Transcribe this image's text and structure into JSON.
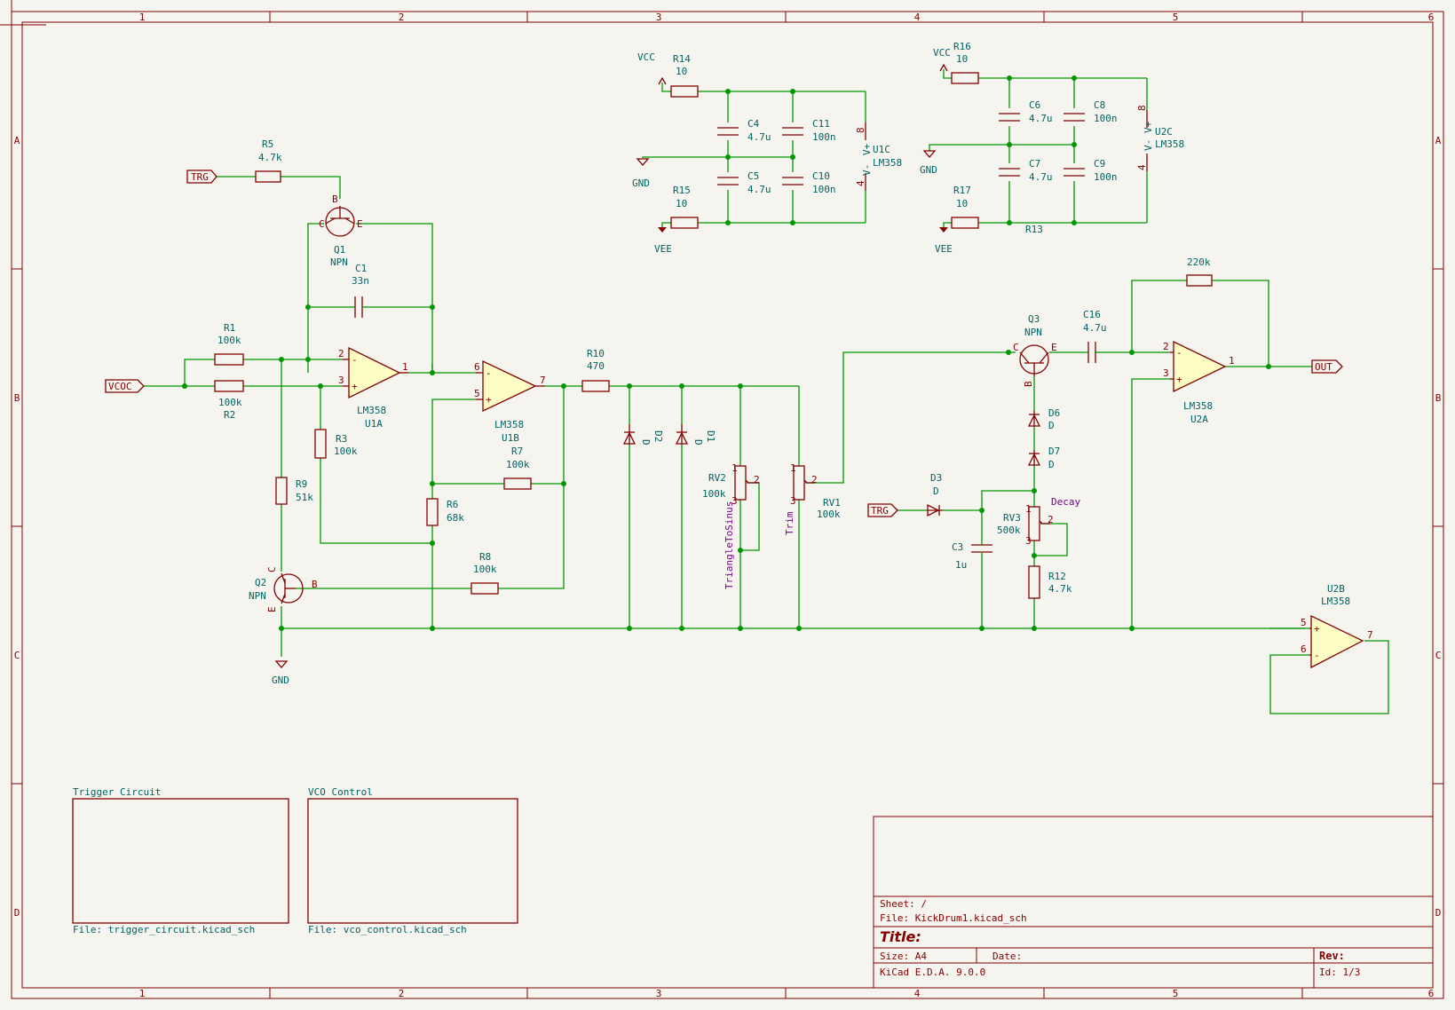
{
  "frame": {
    "columns": [
      "1",
      "2",
      "3",
      "4",
      "5",
      "6"
    ],
    "rows": [
      "A",
      "B",
      "C",
      "D"
    ]
  },
  "title_block": {
    "sheet": "Sheet: /",
    "file": "File: KickDrum1.kicad_sch",
    "title": "Title:",
    "size": "Size: A4",
    "date": "Date:",
    "rev": "Rev:",
    "tool": "KiCad E.D.A. 9.0.0",
    "id": "Id: 1/3"
  },
  "hier_sheets": [
    {
      "name": "Trigger Circuit",
      "file": "File: trigger_circuit.kicad_sch"
    },
    {
      "name": "VCO Control",
      "file": "File: vco_control.kicad_sch"
    }
  ],
  "labels": {
    "trg": "TRG",
    "vcoc": "VCOC",
    "out": "OUT"
  },
  "power": {
    "vcc": "VCC",
    "vee": "VEE",
    "gnd": "GND"
  },
  "components": {
    "r1": {
      "ref": "R1",
      "val": "100k"
    },
    "r2": {
      "ref": "R2",
      "val": "100k"
    },
    "r3": {
      "ref": "R3",
      "val": "100k"
    },
    "r5": {
      "ref": "R5",
      "val": "4.7k"
    },
    "r6": {
      "ref": "R6",
      "val": "68k"
    },
    "r7": {
      "ref": "R7",
      "val": "100k"
    },
    "r8": {
      "ref": "R8",
      "val": "100k"
    },
    "r9": {
      "ref": "R9",
      "val": "51k"
    },
    "r10": {
      "ref": "R10",
      "val": "470"
    },
    "r12": {
      "ref": "R12",
      "val": "4.7k"
    },
    "r13": {
      "ref": "R13",
      "val": "220k"
    },
    "r14": {
      "ref": "R14",
      "val": "10"
    },
    "r15": {
      "ref": "R15",
      "val": "10"
    },
    "r16": {
      "ref": "R16",
      "val": "10"
    },
    "r17": {
      "ref": "R17",
      "val": "10"
    },
    "c1": {
      "ref": "C1",
      "val": "33n"
    },
    "c3": {
      "ref": "C3",
      "val": "1u"
    },
    "c4": {
      "ref": "C4",
      "val": "4.7u"
    },
    "c5": {
      "ref": "C5",
      "val": "4.7u"
    },
    "c6": {
      "ref": "C6",
      "val": "4.7u"
    },
    "c7": {
      "ref": "C7",
      "val": "4.7u"
    },
    "c8": {
      "ref": "C8",
      "val": "100n"
    },
    "c9": {
      "ref": "C9",
      "val": "100n"
    },
    "c10": {
      "ref": "C10",
      "val": "100n"
    },
    "c11": {
      "ref": "C11",
      "val": "100n"
    },
    "c16": {
      "ref": "C16",
      "val": "4.7u"
    },
    "d1": {
      "ref": "D1",
      "val": "D"
    },
    "d2": {
      "ref": "D2",
      "val": "D"
    },
    "d3": {
      "ref": "D3",
      "val": "D"
    },
    "d6": {
      "ref": "D6",
      "val": "D"
    },
    "d7": {
      "ref": "D7",
      "val": "D"
    },
    "q1": {
      "ref": "Q1",
      "val": "NPN"
    },
    "q2": {
      "ref": "Q2",
      "val": "NPN"
    },
    "q3": {
      "ref": "Q3",
      "val": "NPN"
    },
    "rv1": {
      "ref": "RV1",
      "val": "100k",
      "field": "Trim"
    },
    "rv2": {
      "ref": "RV2",
      "val": "100k",
      "field": "TriangleToSinus"
    },
    "rv3": {
      "ref": "RV3",
      "val": "500k",
      "field": "Decay"
    },
    "u1a": {
      "ref": "U1A",
      "val": "LM358"
    },
    "u1b": {
      "ref": "U1B",
      "val": "LM358"
    },
    "u1c": {
      "ref": "U1C",
      "val": "LM358"
    },
    "u2a": {
      "ref": "U2A",
      "val": "LM358"
    },
    "u2b": {
      "ref": "U2B",
      "val": "LM358"
    },
    "u2c": {
      "ref": "U2C",
      "val": "LM358"
    }
  },
  "pins": {
    "minus": "-",
    "plus": "+",
    "p1": "1",
    "p2": "2",
    "p3": "3",
    "p4": "4",
    "p5": "5",
    "p6": "6",
    "p7": "7",
    "p8": "8",
    "vm": "V-",
    "vp": "V+",
    "b": "B",
    "c": "C",
    "e": "E"
  }
}
